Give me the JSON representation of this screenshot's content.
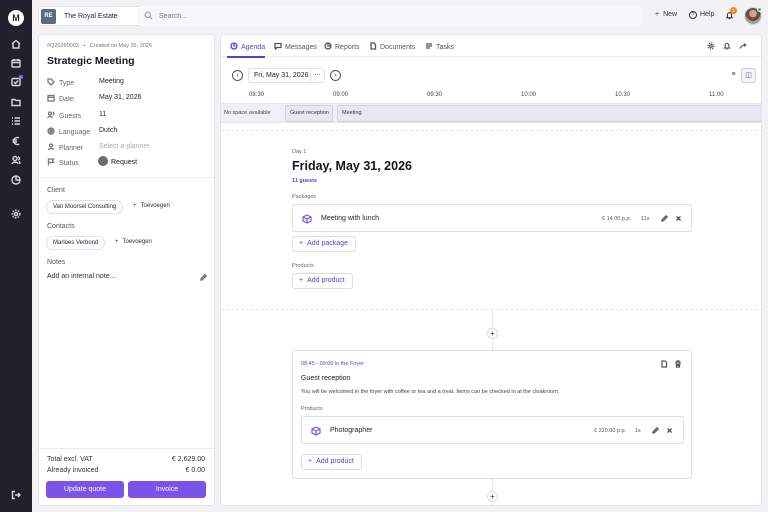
{
  "app": {
    "logo_letter": "M"
  },
  "rail": {
    "items": [
      {
        "icon": "home-icon"
      },
      {
        "icon": "calendar-icon"
      },
      {
        "icon": "bookings-icon",
        "has_dot": true
      },
      {
        "icon": "folder-icon"
      },
      {
        "icon": "tasks-icon"
      },
      {
        "icon": "finance-icon"
      },
      {
        "icon": "contacts-icon"
      },
      {
        "icon": "reports-icon"
      },
      {
        "icon": "settings-icon"
      }
    ],
    "logout_icon": "logout-icon"
  },
  "topbar": {
    "venue_initials": "RE",
    "venue_name": "The Royal Estate",
    "search_placeholder": "Search...",
    "new_label": "New",
    "help_label": "Help",
    "notification_count": "1"
  },
  "booking": {
    "meta_id": "#Q20260003",
    "meta_separator": "•",
    "meta_created": "Created on May 26, 2026",
    "title": "Strategic Meeting",
    "fields": [
      {
        "label": "Type",
        "value": "Meeting"
      },
      {
        "label": "Date",
        "value": "May 31, 2026"
      },
      {
        "label": "Guests",
        "value": "11"
      },
      {
        "label": "Language",
        "value": "Dutch"
      },
      {
        "label": "Planner",
        "value": "Select a planner"
      },
      {
        "label": "Status",
        "value": "Request"
      }
    ],
    "client_heading": "Client",
    "client_name": "Van Moorsel Consulting",
    "client_add": "Toevoegen",
    "contacts_heading": "Contacts",
    "contact_name": "Marloes Verbond",
    "contact_add": "Toevoegen",
    "notes_heading": "Notes",
    "notes_add": "Add an internal note...",
    "total_label": "Total excl. VAT",
    "total_value": "€ 2,629.00",
    "invoiced_label": "Already invoiced",
    "invoiced_value": "€ 0.00",
    "update_quote": "Update quote",
    "invoice": "Invoice"
  },
  "tabs": [
    {
      "label": "Agenda",
      "active": true
    },
    {
      "label": "Messages"
    },
    {
      "label": "Reports"
    },
    {
      "label": "Documents"
    },
    {
      "label": "Tasks"
    }
  ],
  "agenda": {
    "date_value": "Fri, May 31, 2026",
    "date_more": "...",
    "times": [
      "08:30",
      "09:00",
      "09:30",
      "10:00",
      "10:30",
      "11:00"
    ],
    "timeline": {
      "no_space": "No space available",
      "block1": "Guest reception",
      "block2": "Meeting"
    },
    "day_label": "Day 1",
    "day_title": "Friday, May 31, 2026",
    "guests": "11 guests",
    "packages_label": "Packages",
    "package": {
      "name": "Meeting with lunch",
      "price": "€ 14.00 p.p.",
      "qty": "11x"
    },
    "add_package": "Add package",
    "products_label": "Products",
    "add_product": "Add product",
    "event": {
      "time": "08:45 - 09:00 in the Foyer",
      "title": "Guest reception",
      "description": "You will be welcomed in the foyer with coffee or tea and a treat. Items can be checked in at the cloakroom.",
      "products_label": "Products",
      "product": {
        "name": "Photographer",
        "price": "€ 220.00 p.p.",
        "qty": "1x"
      },
      "add_product": "Add product"
    }
  },
  "colors": {
    "accent": "#7c53e8",
    "rail": "#23202e",
    "notification": "#f08a24"
  }
}
